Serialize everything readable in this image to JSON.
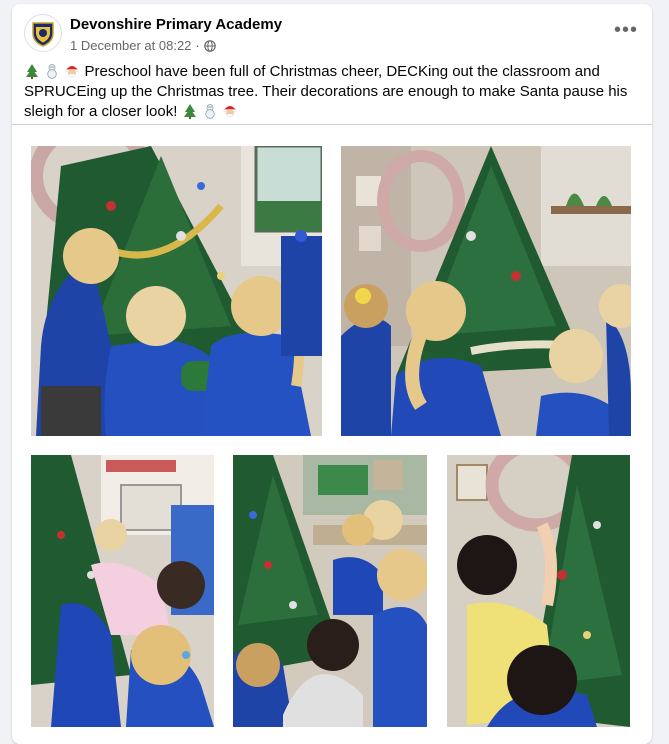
{
  "post": {
    "page_name": "Devonshire Primary Academy",
    "timestamp": "1 December at 08:22",
    "separator": "·",
    "privacy_icon": "globe-icon",
    "more_icon": "more-horizontal-icon",
    "text": "Preschool have been full of Christmas cheer, DECKing out the classroom and SPRUCEing up the Christmas tree.  Their decorations are enough to make Santa pause his sleigh for a closer look!",
    "emoji_prefix": [
      "christmas-tree-icon",
      "snowman-icon",
      "santa-icon"
    ],
    "emoji_suffix": [
      "christmas-tree-icon",
      "snowman-icon",
      "santa-icon"
    ]
  },
  "photos": [
    {
      "name": "photo-children-decorating-tree-1"
    },
    {
      "name": "photo-children-decorating-tree-2"
    },
    {
      "name": "photo-children-decorating-tree-3"
    },
    {
      "name": "photo-children-decorating-tree-4"
    },
    {
      "name": "photo-children-decorating-tree-5"
    }
  ],
  "colors": {
    "page_bg": "#f0f2f5",
    "card_bg": "#ffffff",
    "text": "#050505",
    "secondary": "#65676b",
    "uniform_blue": "#1f47b5",
    "tree_green": "#1f5a30"
  }
}
